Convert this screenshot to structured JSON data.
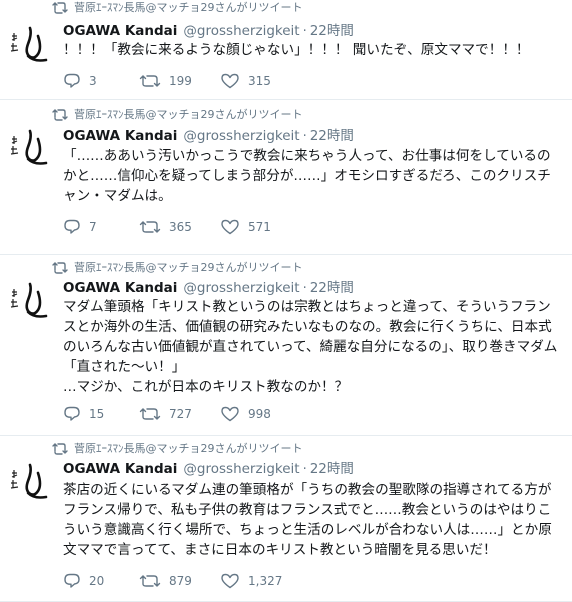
{
  "tweets": [
    {
      "retweeted_by": "菅原ｴｰｽﾏﾝ長馬@マッチョ29さんがリツイート",
      "name": "OGAWA Kandai",
      "handle": "@grossherzigkeit",
      "time": "22時間",
      "text": "！！！「教会に来るような顔じゃない」！！！ 聞いたぞ、原文ママで！！！",
      "replies": "3",
      "retweets": "199",
      "likes": "315"
    },
    {
      "retweeted_by": "菅原ｴｰｽﾏﾝ長馬@マッチョ29さんがリツイート",
      "name": "OGAWA Kandai",
      "handle": "@grossherzigkeit",
      "time": "22時間",
      "text": "「……ああいう汚いかっこうで教会に来ちゃう人って、お仕事は何をしているのかと……信仰心を疑ってしまう部分が……」オモシロすぎるだろ、このクリスチャン・マダムは。",
      "replies": "7",
      "retweets": "365",
      "likes": "571"
    },
    {
      "retweeted_by": "菅原ｴｰｽﾏﾝ長馬@マッチョ29さんがリツイート",
      "name": "OGAWA Kandai",
      "handle": "@grossherzigkeit",
      "time": "22時間",
      "text": "マダム筆頭格「キリスト教というのは宗教とはちょっと違って、そういうフランスとか海外の生活、価値観の研究みたいなものなの。教会に行くうちに、日本式のいろんな古い価値観が直されていって、綺麗な自分になるの」、取り巻きマダム「直された〜い！」\n…マジか、これが日本のキリスト教なのか！？",
      "replies": "15",
      "retweets": "727",
      "likes": "998"
    },
    {
      "retweeted_by": "菅原ｴｰｽﾏﾝ長馬@マッチョ29さんがリツイート",
      "name": "OGAWA Kandai",
      "handle": "@grossherzigkeit",
      "time": "22時間",
      "text": "茶店の近くにいるマダム連の筆頭格が「うちの教会の聖歌隊の指導されてる方がフランス帰りで、私も子供の教育はフランス式でと……教会というのはやはりこういう意識高く行く場所で、ちょっと生活のレベルが合わない人は……」とか原文ママで言ってて、まさに日本のキリスト教という暗闇を見る思いだ！",
      "replies": "20",
      "retweets": "879",
      "likes": "1,327"
    }
  ],
  "icons": {
    "retweet": "retweet-icon",
    "reply": "reply-icon",
    "like": "heart-icon",
    "avatar": "calligraphy-avatar"
  },
  "colors": {
    "text": "#14171a",
    "muted": "#657786",
    "divider": "#e6ecf0"
  }
}
